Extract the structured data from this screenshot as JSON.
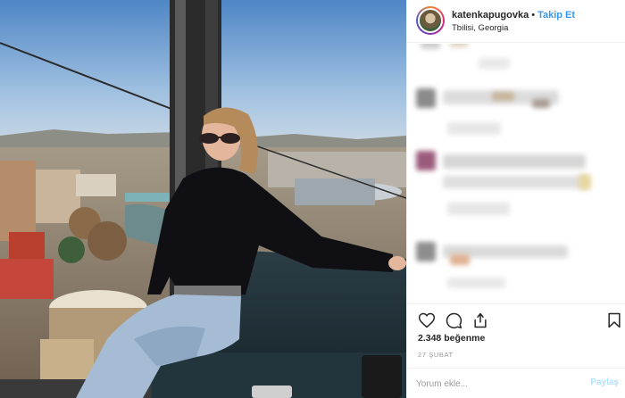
{
  "post": {
    "username": "katenkapugovka",
    "separator": "•",
    "follow_label": "Takip Et",
    "location": "Tbilisi, Georgia",
    "likes": "2.348 beğenme",
    "date": "27 ŞUBAT"
  },
  "icons": {
    "like": "heart-icon",
    "comment": "comment-icon",
    "share": "share-icon",
    "save": "bookmark-icon"
  },
  "comment_box": {
    "placeholder": "Yorum ekle...",
    "post_label": "Paylaş"
  },
  "colors": {
    "accent": "#3897f0",
    "post_disabled": "#b2dffc",
    "border": "#efefef"
  }
}
